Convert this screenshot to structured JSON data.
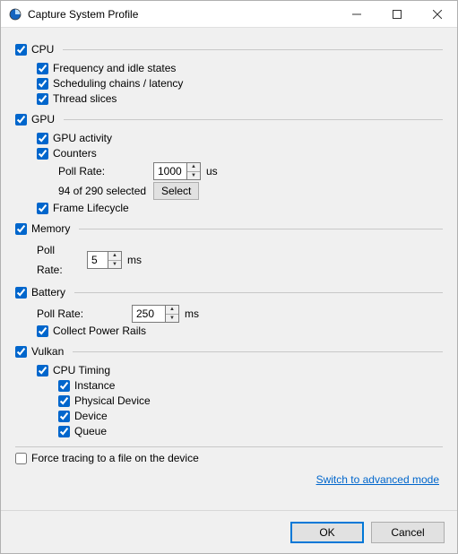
{
  "window": {
    "title": "Capture System Profile"
  },
  "cpu": {
    "label": "CPU",
    "freq": "Frequency and idle states",
    "sched": "Scheduling chains / latency",
    "slices": "Thread slices"
  },
  "gpu": {
    "label": "GPU",
    "activity": "GPU activity",
    "counters": "Counters",
    "poll_label": "Poll Rate:",
    "poll_value": "1000",
    "poll_unit": "us",
    "sel_text": "94 of 290 selected",
    "select_btn": "Select",
    "frame": "Frame Lifecycle"
  },
  "memory": {
    "label": "Memory",
    "poll_label": "Poll Rate:",
    "poll_value": "5",
    "poll_unit": "ms"
  },
  "battery": {
    "label": "Battery",
    "poll_label": "Poll Rate:",
    "poll_value": "250",
    "poll_unit": "ms",
    "rails": "Collect Power Rails"
  },
  "vulkan": {
    "label": "Vulkan",
    "cpu_timing": "CPU Timing",
    "instance": "Instance",
    "physical": "Physical Device",
    "device": "Device",
    "queue": "Queue"
  },
  "force_file": "Force tracing to a file on the device",
  "advanced_link": "Switch to advanced mode",
  "buttons": {
    "ok": "OK",
    "cancel": "Cancel"
  }
}
